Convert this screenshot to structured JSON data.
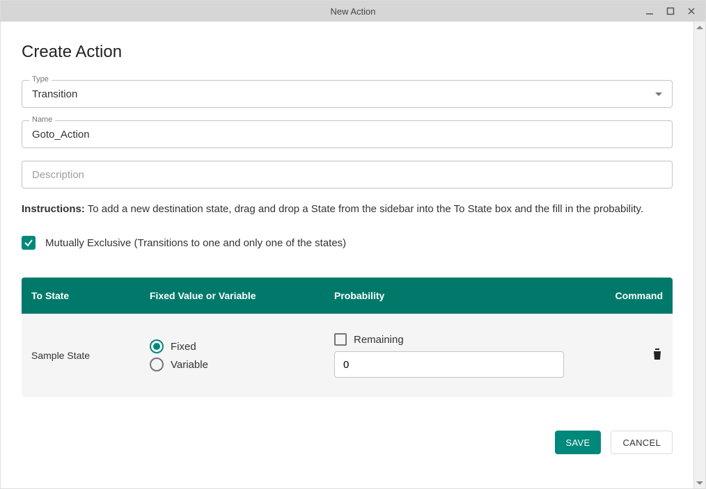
{
  "window": {
    "title": "New Action"
  },
  "heading": "Create Action",
  "fields": {
    "type": {
      "label": "Type",
      "value": "Transition"
    },
    "name": {
      "label": "Name",
      "value": "Goto_Action"
    },
    "description": {
      "placeholder": "Description",
      "value": ""
    }
  },
  "instructions": {
    "label": "Instructions:",
    "text": "To add a new destination state, drag and drop a State from the sidebar into the To State box and the fill in the probability."
  },
  "mutually_exclusive": {
    "checked": true,
    "label": "Mutually Exclusive (Transitions to one and only one of the states)"
  },
  "table": {
    "headers": {
      "state": "To State",
      "fixed": "Fixed Value or Variable",
      "prob": "Probability",
      "cmd": "Command"
    },
    "row": {
      "state": "Sample State",
      "radio_fixed": "Fixed",
      "radio_variable": "Variable",
      "remaining_label": "Remaining",
      "prob_value": "0"
    }
  },
  "buttons": {
    "save": "SAVE",
    "cancel": "CANCEL"
  },
  "colors": {
    "teal": "#00897b",
    "teal_dark": "#00796b"
  }
}
